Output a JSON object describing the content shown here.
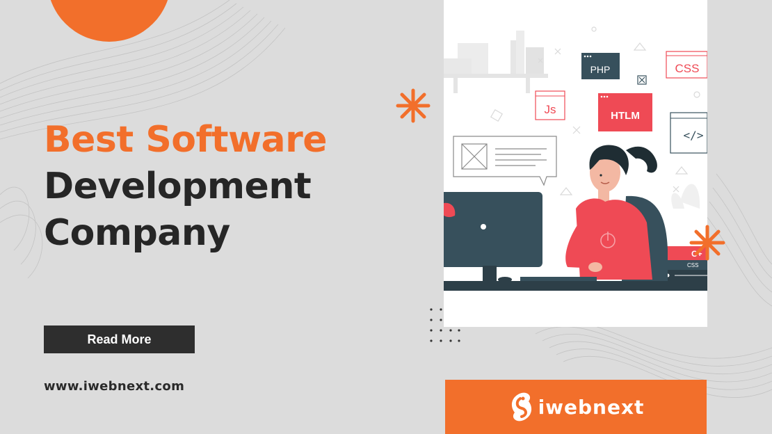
{
  "headline": {
    "line1": "Best Software",
    "line2": "Development",
    "line3": "Company"
  },
  "cta": {
    "label": "Read More"
  },
  "website": "www.iwebnext.com",
  "brand": {
    "name": "iwebnext"
  },
  "illustration": {
    "tags": {
      "php": "PHP",
      "css": "CSS",
      "js": "Js",
      "htlm": "HTLM",
      "code": "</>",
      "cplus": "C+",
      "css_book": "CSS"
    }
  },
  "colors": {
    "accent": "#f26f2b",
    "dark": "#262626",
    "background": "#dcdcdc",
    "illustration_red": "#ef4a55",
    "illustration_slate": "#37505c"
  },
  "icons": [
    "asterisk-icon",
    "dot-grid-icon",
    "brand-logo-icon"
  ]
}
